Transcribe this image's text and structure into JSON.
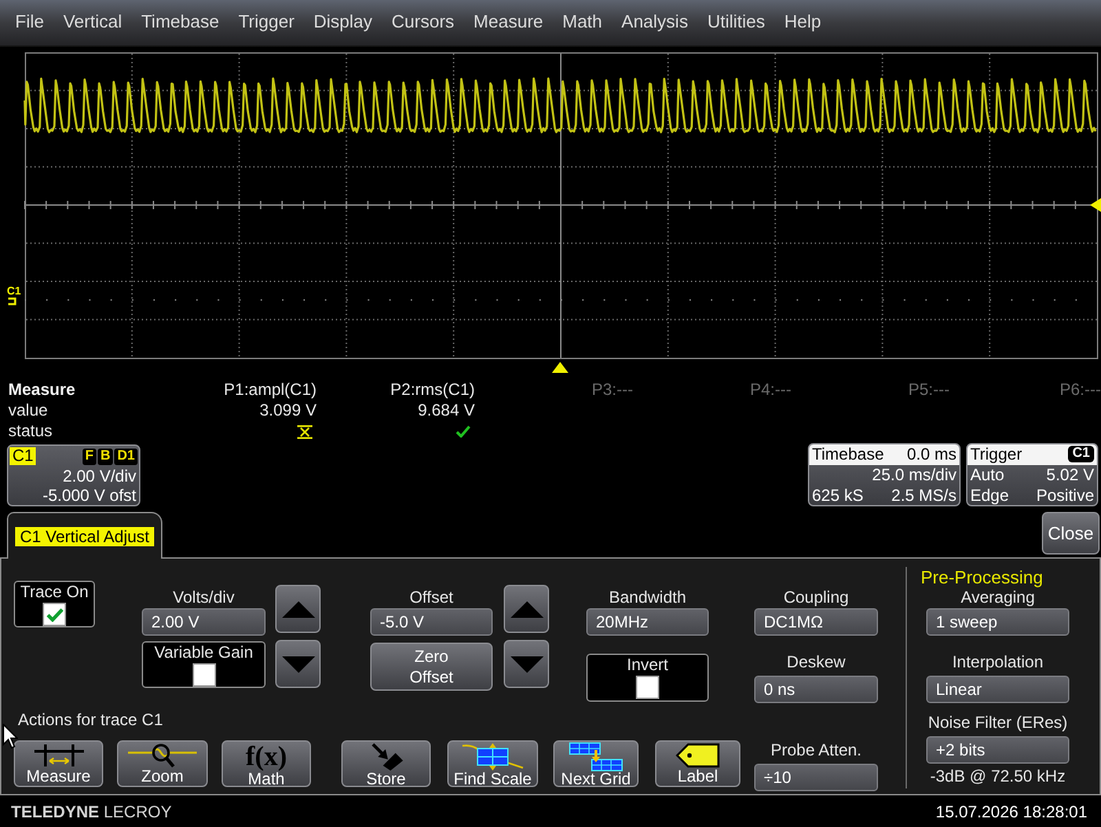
{
  "menu_bar": {
    "items": [
      "File",
      "Vertical",
      "Timebase",
      "Trigger",
      "Display",
      "Cursors",
      "Measure",
      "Math",
      "Analysis",
      "Utilities",
      "Help"
    ]
  },
  "display": {
    "channel_label": "C1"
  },
  "measure": {
    "title": "Measure",
    "row_labels": [
      "value",
      "status"
    ],
    "parameters": [
      {
        "label": "P1:ampl(C1)",
        "active": true,
        "value": "3.099 V",
        "status_ok": false
      },
      {
        "label": "P2:rms(C1)",
        "active": true,
        "value": "9.684 V",
        "status_ok": true
      },
      {
        "label": "P3:---",
        "active": false
      },
      {
        "label": "P4:---",
        "active": false
      },
      {
        "label": "P5:---",
        "active": false
      },
      {
        "label": "P6:---",
        "active": false
      }
    ]
  },
  "channel_descriptor": {
    "channel": "C1",
    "flags": [
      "F",
      "B",
      "D1"
    ],
    "scale": "2.00 V/div",
    "offset": "-5.000 V ofst"
  },
  "timebase_descriptor": {
    "title": "Timebase",
    "delay": "0.0 ms",
    "scale": "25.0 ms/div",
    "samples": "625 kS",
    "sample_rate": "2.5 MS/s"
  },
  "trigger_descriptor": {
    "title": "Trigger",
    "source": "C1",
    "mode": "Auto",
    "threshold": "5.02 V",
    "type": "Edge",
    "slope": "Positive"
  },
  "dialog": {
    "tabs": [
      {
        "label": "C1 Vertical Adjust",
        "selected": true
      }
    ],
    "close_button": "Close",
    "trace_on": {
      "label": "Trace On",
      "checked": true
    },
    "volts_div": {
      "label": "Volts/div",
      "value": "2.00 V"
    },
    "variable_gain": {
      "label": "Variable Gain",
      "checked": false
    },
    "offset": {
      "label": "Offset",
      "value": "-5.0 V"
    },
    "zero_offset_button": "Zero Offset",
    "bandwidth": {
      "label": "Bandwidth",
      "value": "20MHz"
    },
    "invert": {
      "label": "Invert",
      "checked": false
    },
    "coupling": {
      "label": "Coupling",
      "value": "DC1MΩ"
    },
    "deskew": {
      "label": "Deskew",
      "value": "0 ns"
    },
    "actions": {
      "title": "Actions for trace C1",
      "buttons": [
        {
          "kind": "measure",
          "label": "Measure"
        },
        {
          "kind": "zoom",
          "label": "Zoom"
        },
        {
          "kind": "math",
          "symbol": "f(x)",
          "label": "Math"
        },
        {
          "kind": "store",
          "label": "Store"
        },
        {
          "kind": "find_scale",
          "label": "Find Scale"
        },
        {
          "kind": "next_grid",
          "label": "Next Grid"
        },
        {
          "kind": "label",
          "label": "Label"
        }
      ]
    },
    "probe_atten": {
      "label": "Probe Atten.",
      "value": "÷10"
    },
    "pre_processing": {
      "title": "Pre-Processing",
      "averaging": {
        "label": "Averaging",
        "value": "1 sweep"
      },
      "interpolation": {
        "label": "Interpolation",
        "value": "Linear"
      },
      "noise_filter": {
        "label": "Noise Filter (ERes)",
        "value": "+2 bits",
        "cutoff": "-3dB @ 72.50 kHz"
      }
    }
  },
  "footer": {
    "brand": "**TELEDYNE** LECROY",
    "timestamp": "15.07.2026 18:28:01"
  }
}
